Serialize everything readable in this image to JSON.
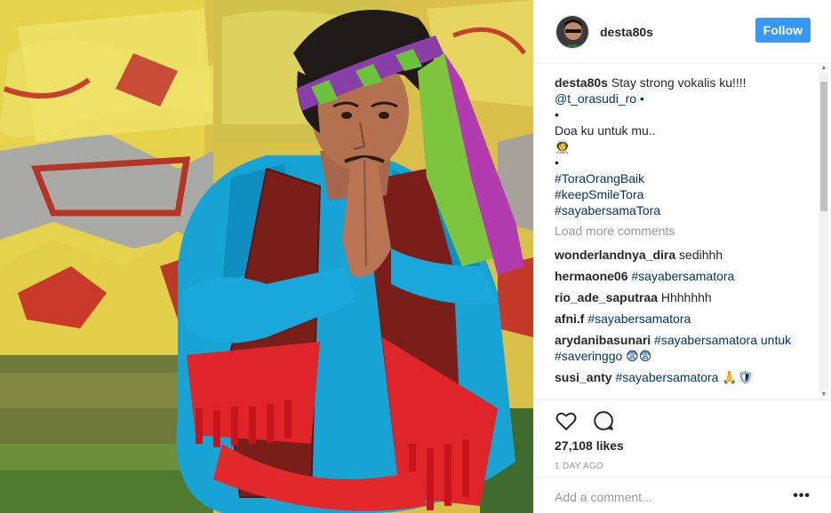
{
  "post": {
    "username": "desta80s",
    "follow_label": "Follow",
    "caption": {
      "user": "desta80s",
      "text": "Stay strong vokalis ku!!!!",
      "lines": [
        "@t_orasudi_ro •",
        "•",
        "Doa ku untuk mu..",
        "👩‍🚀",
        "•"
      ],
      "hashtags": [
        "#ToraOrangBaik",
        "#keepSmileTora",
        "#sayabersamaTora"
      ]
    },
    "load_more": "Load more comments",
    "comments": [
      {
        "user": "wonderlandnya_dira",
        "text": "sedihhh"
      },
      {
        "user": "hermaone06",
        "text": "#sayabersamatora"
      },
      {
        "user": "rio_ade_saputraa",
        "text": "Hhhhhhh"
      },
      {
        "user": "afni.f",
        "text": "#sayabersamatora"
      },
      {
        "user": "arydanibasunari",
        "text": "#sayabersamatora untuk",
        "text2": "#saveringgo 😨😨"
      },
      {
        "user": "susi_anty",
        "text": "#sayabersamatora 🙏🛡"
      }
    ],
    "likes": "27,108 likes",
    "date": "1 DAY AGO",
    "add_comment_placeholder": "Add a comment...",
    "more_label": "•••",
    "colors": {
      "accent": "#3897f0",
      "hashtag": "#003569",
      "muted": "#999999",
      "text": "#262626"
    },
    "icons": [
      "heart-icon",
      "comment-icon",
      "more-options-icon"
    ]
  }
}
